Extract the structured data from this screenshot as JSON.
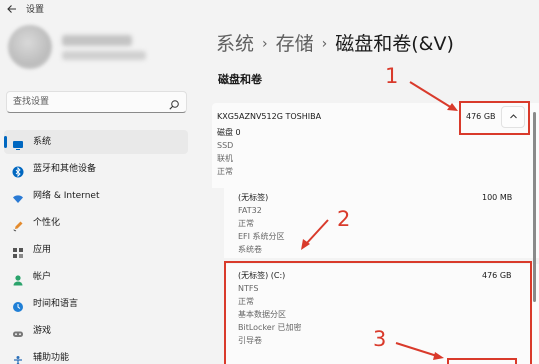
{
  "window": {
    "title": "设置",
    "back_icon": "back-arrow-icon"
  },
  "search": {
    "placeholder": "查找设置",
    "icon": "search-icon"
  },
  "sidebar": {
    "items": [
      {
        "label": "系统",
        "icon": "system-icon",
        "active": true,
        "color": "#0067c0"
      },
      {
        "label": "蓝牙和其他设备",
        "icon": "bluetooth-icon",
        "color": "#0067c0"
      },
      {
        "label": "网络 & Internet",
        "icon": "network-icon",
        "color": "#2a7ad4"
      },
      {
        "label": "个性化",
        "icon": "personalization-icon",
        "color": "#e38a2c"
      },
      {
        "label": "应用",
        "icon": "apps-icon",
        "color": "#545454"
      },
      {
        "label": "帐户",
        "icon": "account-icon",
        "color": "#2aa36b"
      },
      {
        "label": "时间和语言",
        "icon": "time-language-icon",
        "color": "#1f7fd6"
      },
      {
        "label": "游戏",
        "icon": "gaming-icon",
        "color": "#777777"
      },
      {
        "label": "辅助功能",
        "icon": "accessibility-icon",
        "color": "#2b6fb8"
      }
    ]
  },
  "breadcrumb": {
    "items": [
      "系统",
      "存储",
      "磁盘和卷(&V)"
    ],
    "separator": "›"
  },
  "section": {
    "title": "磁盘和卷"
  },
  "disk": {
    "name": "KXG5AZNV512G TOSHIBA",
    "number": "磁盘 0",
    "type": "SSD",
    "status": "联机",
    "health": "正常",
    "size": "476 GB",
    "collapse_icon": "chevron-up-icon"
  },
  "volumes": [
    {
      "label": "(无标签)",
      "filesystem": "FAT32",
      "health": "正常",
      "partition": "EFI 系统分区",
      "role": "系统卷",
      "size": "100 MB"
    },
    {
      "label": "(无标签) (C:)",
      "filesystem": "NTFS",
      "health": "正常",
      "partition": "基本数据分区",
      "bitlocker": "BitLocker 已加密",
      "role": "引导卷",
      "size": "476 GB"
    }
  ],
  "annotations": {
    "n1": "1",
    "n2": "2",
    "n3": "3",
    "color": "#d93a2b"
  }
}
